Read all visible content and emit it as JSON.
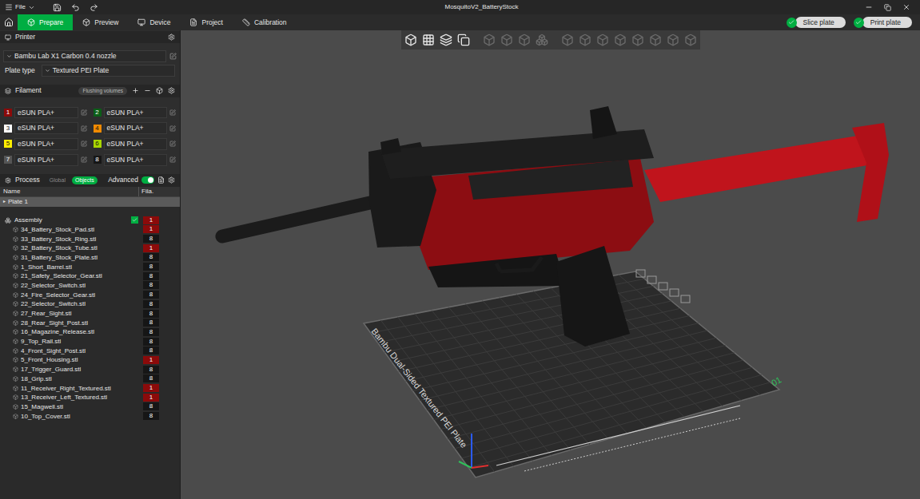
{
  "window": {
    "title": "MosquitoV2_BatteryStock",
    "menu": "File"
  },
  "tabs": [
    {
      "label": "Prepare",
      "selected": true
    },
    {
      "label": "Preview",
      "selected": false
    },
    {
      "label": "Device",
      "selected": false
    },
    {
      "label": "Project",
      "selected": false
    },
    {
      "label": "Calibration",
      "selected": false
    }
  ],
  "actions": [
    {
      "label": "Slice plate"
    },
    {
      "label": "Print plate"
    }
  ],
  "printer": {
    "header": "Printer",
    "name": "Bambu Lab X1 Carbon 0.4 nozzle",
    "plate_type_label": "Plate type",
    "plate_type": "Textured PEI Plate"
  },
  "filament": {
    "header": "Filament",
    "flushing": "Flushing volumes",
    "items": [
      {
        "index": "1",
        "name": "eSUN PLA+",
        "color": "#8b0a0a"
      },
      {
        "index": "2",
        "name": "eSUN PLA+",
        "color": "#0b5e17"
      },
      {
        "index": "3",
        "name": "eSUN PLA+",
        "color": "#ffffff"
      },
      {
        "index": "4",
        "name": "eSUN PLA+",
        "color": "#f08a00"
      },
      {
        "index": "5",
        "name": "eSUN PLA+",
        "color": "#ffee00"
      },
      {
        "index": "6",
        "name": "eSUN PLA+",
        "color": "#a8d600"
      },
      {
        "index": "7",
        "name": "eSUN PLA+",
        "color": "#555555"
      },
      {
        "index": "8",
        "name": "eSUN PLA+",
        "color": "#161616"
      }
    ]
  },
  "process": {
    "header": "Process",
    "modes": [
      {
        "label": "Global",
        "selected": false
      },
      {
        "label": "Objects",
        "selected": true
      }
    ],
    "advanced": {
      "label": "Advanced",
      "on": true
    }
  },
  "objects": {
    "columns": [
      "Name",
      "Fila."
    ],
    "plate": {
      "label": "Plate 1",
      "selected": true
    },
    "assembly": {
      "name": "Assembly",
      "checked": true,
      "filament": "1"
    },
    "items": [
      {
        "name": "34_Battery_Stock_Pad.stl",
        "filament": "1"
      },
      {
        "name": "33_Battery_Stock_Ring.stl",
        "filament": "8"
      },
      {
        "name": "32_Battery_Stock_Tube.stl",
        "filament": "1"
      },
      {
        "name": "31_Battery_Stock_Plate.stl",
        "filament": "8"
      },
      {
        "name": "1_Short_Barrel.stl",
        "filament": "8"
      },
      {
        "name": "21_Safety_Selector_Gear.stl",
        "filament": "8"
      },
      {
        "name": "22_Selector_Switch.stl",
        "filament": "8"
      },
      {
        "name": "24_Fire_Selector_Gear.stl",
        "filament": "8"
      },
      {
        "name": "22_Selector_Switch.stl",
        "filament": "8"
      },
      {
        "name": "27_Rear_Sight.stl",
        "filament": "8"
      },
      {
        "name": "28_Rear_Sight_Post.stl",
        "filament": "8"
      },
      {
        "name": "16_Magazine_Release.stl",
        "filament": "8"
      },
      {
        "name": "9_Top_Rail.stl",
        "filament": "8"
      },
      {
        "name": "4_Front_Sight_Post.stl",
        "filament": "8"
      },
      {
        "name": "5_Front_Housing.stl",
        "filament": "1"
      },
      {
        "name": "17_Trigger_Guard.stl",
        "filament": "8"
      },
      {
        "name": "18_Grip.stl",
        "filament": "8"
      },
      {
        "name": "11_Receiver_Right_Textured.stl",
        "filament": "1"
      },
      {
        "name": "13_Receiver_Left_Textured.stl",
        "filament": "1"
      },
      {
        "name": "15_Magwell.stl",
        "filament": "8"
      },
      {
        "name": "10_Top_Cover.stl",
        "filament": "8"
      }
    ]
  },
  "viewport": {
    "plate_label": "Bambu Dual-Sided Textured PEI Plate",
    "plate_number": "01"
  }
}
